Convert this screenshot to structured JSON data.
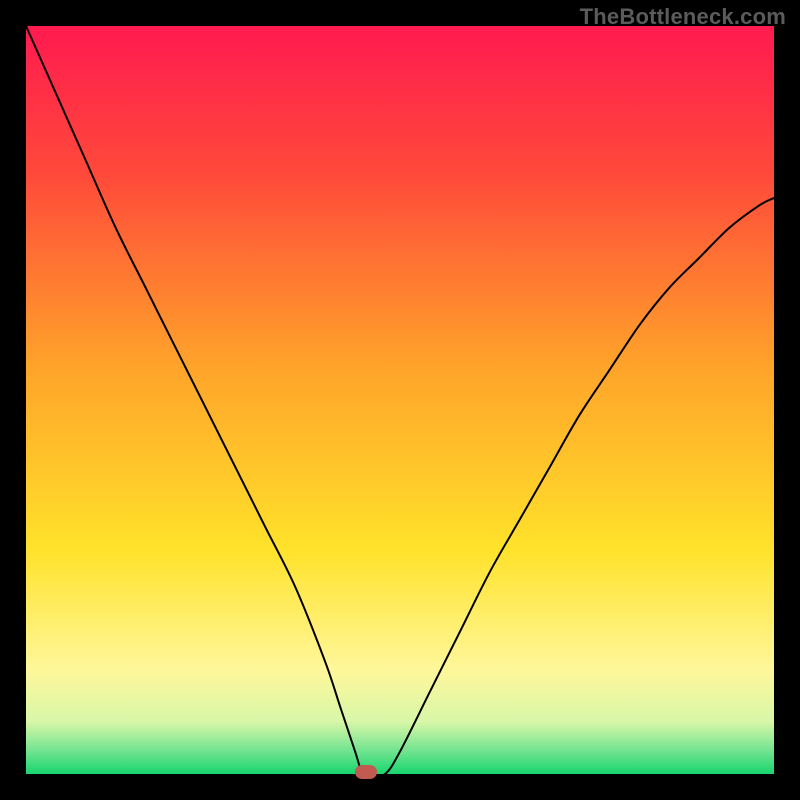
{
  "watermark": "TheBottleneck.com",
  "chart_data": {
    "type": "line",
    "title": "",
    "xlabel": "",
    "ylabel": "",
    "xlim": [
      0,
      100
    ],
    "ylim": [
      0,
      100
    ],
    "background_gradient": {
      "stops": [
        {
          "pos": 0.0,
          "color": "#ff1a50"
        },
        {
          "pos": 0.2,
          "color": "#ff4a3a"
        },
        {
          "pos": 0.45,
          "color": "#ffa22a"
        },
        {
          "pos": 0.7,
          "color": "#ffe22a"
        },
        {
          "pos": 0.86,
          "color": "#fff79a"
        },
        {
          "pos": 0.93,
          "color": "#d8f7a8"
        },
        {
          "pos": 0.97,
          "color": "#6fe38f"
        },
        {
          "pos": 1.0,
          "color": "#17d66e"
        }
      ]
    },
    "series": [
      {
        "name": "bottleneck-curve",
        "x": [
          0,
          4,
          8,
          12,
          16,
          20,
          24,
          28,
          32,
          36,
          40,
          42,
          44,
          45,
          46,
          48,
          50,
          54,
          58,
          62,
          66,
          70,
          74,
          78,
          82,
          86,
          90,
          94,
          98,
          100
        ],
        "values": [
          100,
          91,
          82,
          73,
          65,
          57,
          49,
          41,
          33,
          25,
          15,
          9,
          3,
          0,
          0,
          0,
          3,
          11,
          19,
          27,
          34,
          41,
          48,
          54,
          60,
          65,
          69,
          73,
          76,
          77
        ]
      }
    ],
    "marker": {
      "x": 45.5,
      "y": 0,
      "color": "#c15a50"
    }
  }
}
